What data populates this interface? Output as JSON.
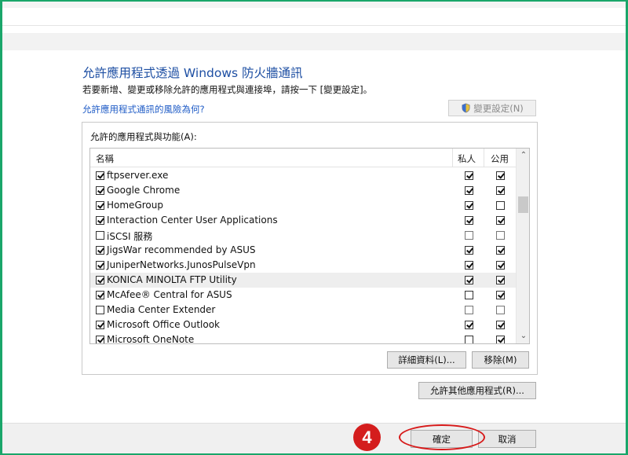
{
  "dialog": {
    "title": "允許應用程式透過 Windows 防火牆通訊",
    "description": "若要新增、變更或移除允許的應用程式與連接埠，請按一下 [變更設定]。",
    "risk_link": "允許應用程式通訊的風險為何?",
    "change_settings_label": "變更設定(N)"
  },
  "apps": {
    "group_label": "允許的應用程式與功能(A):",
    "columns": {
      "name": "名稱",
      "private": "私人",
      "public": "公用"
    },
    "rows": [
      {
        "name": "ftpserver.exe",
        "enabled": true,
        "private": true,
        "public": true
      },
      {
        "name": "Google Chrome",
        "enabled": true,
        "private": true,
        "public": true
      },
      {
        "name": "HomeGroup",
        "enabled": true,
        "private": true,
        "public": false
      },
      {
        "name": "Interaction Center User Applications",
        "enabled": true,
        "private": true,
        "public": true
      },
      {
        "name": "iSCSI 服務",
        "enabled": false,
        "private": false,
        "public": false
      },
      {
        "name": "JigsWar recommended by ASUS",
        "enabled": true,
        "private": true,
        "public": true
      },
      {
        "name": "JuniperNetworks.JunosPulseVpn",
        "enabled": true,
        "private": true,
        "public": true
      },
      {
        "name": "KONICA MINOLTA FTP Utility",
        "enabled": true,
        "private": true,
        "public": true,
        "selected": true
      },
      {
        "name": "McAfee® Central for ASUS",
        "enabled": true,
        "private": false,
        "public": true
      },
      {
        "name": "Media Center Extender",
        "enabled": false,
        "private": false,
        "public": false
      },
      {
        "name": "Microsoft Office Outlook",
        "enabled": true,
        "private": true,
        "public": true
      },
      {
        "name": "Microsoft OneNote",
        "enabled": true,
        "private": false,
        "public": true
      }
    ],
    "details_label": "詳細資料(L)...",
    "remove_label": "移除(M)",
    "allow_other_label": "允許其他應用程式(R)..."
  },
  "footer": {
    "ok_label": "確定",
    "cancel_label": "取消"
  },
  "annotation": {
    "step_number": "4",
    "color": "#d41d1d"
  }
}
